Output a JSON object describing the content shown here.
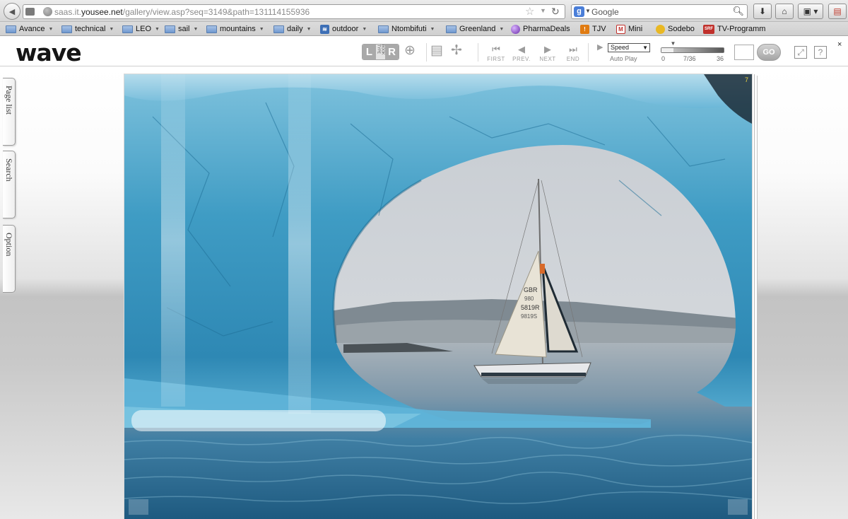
{
  "browser": {
    "url_prefix": "saas.it.",
    "url_domain": "yousee.net",
    "url_path": "/gallery/view.asp?seq=3149&path=131114155936",
    "search_placeholder": "Google",
    "bookmarks": [
      {
        "label": "Avance",
        "type": "folder"
      },
      {
        "label": "technical",
        "type": "folder"
      },
      {
        "label": "LEO",
        "type": "folder"
      },
      {
        "label": "sail",
        "type": "folder"
      },
      {
        "label": "mountains",
        "type": "folder"
      },
      {
        "label": "daily",
        "type": "folder"
      },
      {
        "label": "outdoor",
        "type": "feed"
      },
      {
        "label": "Ntombifuti",
        "type": "folder"
      },
      {
        "label": "Greenland",
        "type": "folder"
      },
      {
        "label": "PharmaDeals",
        "type": "site"
      },
      {
        "label": "TJV",
        "type": "site"
      },
      {
        "label": "Mini",
        "type": "site"
      },
      {
        "label": "Sodebo",
        "type": "site"
      },
      {
        "label": "TV-Programm",
        "type": "site",
        "badge": "SRF"
      }
    ]
  },
  "viewer": {
    "logo": "wave",
    "book_left": "L",
    "book_right": "R",
    "book_mid": "BOOK TYPE",
    "nav": {
      "first": "FIRST",
      "prev": "PREV.",
      "next": "NEXT",
      "end": "END"
    },
    "speed_label": "Speed",
    "autoplay_label": "Auto Play",
    "slider": {
      "min": "0",
      "current": "7/36",
      "max": "36",
      "value": 7,
      "total": 36
    },
    "go_label": "GO",
    "help_label": "?",
    "close_label": "×",
    "page_number": "7"
  },
  "side_tabs": {
    "page_list": "Page list",
    "search": "Search",
    "option": "Option"
  },
  "photo": {
    "sail_number_1": "GBR",
    "sail_number_2": "980",
    "sail_number_3": "5819R",
    "sail_number_4": "9819S"
  },
  "colors": {
    "accent_gray": "#a9a9a9",
    "ice_blue": "#3f9cc4",
    "sea": "#2e6f92"
  }
}
